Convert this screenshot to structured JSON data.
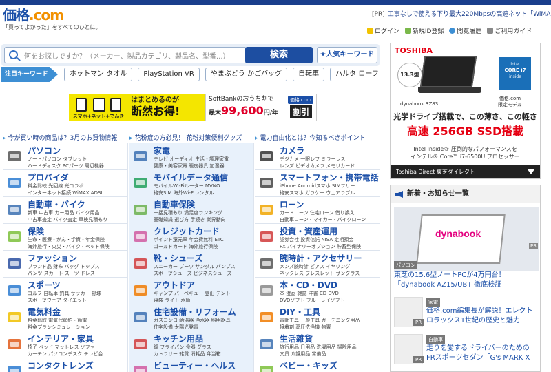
{
  "header": {
    "logo_main": "価格",
    "logo_dot": ".com",
    "tagline": "「買ってよかった」をすべてのひとに。",
    "pr_tag": "[PR]",
    "pr_text": "工事なしで使える下り最大220Mbpsの高速ネット「WiMAX」解説",
    "nav": [
      {
        "label": "ログイン",
        "icon": "key-icon",
        "color": "#f2c300"
      },
      {
        "label": "新規ID登録",
        "icon": "add-user-icon",
        "color": "#7ab84a"
      },
      {
        "label": "閲覧履歴",
        "icon": "history-icon",
        "color": "#3d8fd4"
      },
      {
        "label": "ご利用ガイド",
        "icon": "guide-icon",
        "color": "#888888"
      }
    ]
  },
  "search": {
    "placeholder": "何をお探しですか？（メーカー、製品カテゴリ、製品名、型番...）",
    "button": "検索",
    "popular": "★人気キーワード"
  },
  "keywords": {
    "label": "注目キーワード",
    "items": [
      "ホットマン タオル",
      "PlayStation VR",
      "やまぶどう かごバッグ",
      "自転車",
      "ハルタ ローファ"
    ]
  },
  "banner": {
    "tiles": [
      "スマホ",
      "ネット",
      "でんき"
    ],
    "line1": "はまとめるのが",
    "line2": "断然お得!",
    "sb": "SoftBankのおうち割で",
    "max": "最大",
    "amount": "99,600",
    "unit": "円/年",
    "discount": "割引",
    "brand": "価格.com"
  },
  "promos": [
    "今が買い時の商品は？3月のお買物情報",
    "花粉症の方必見！ 花粉対策便利グッズ",
    "電力自由化とは？今知るべきポイント"
  ],
  "categories": [
    {
      "title": "パソコン",
      "sub": [
        "ノートパソコン タブレット",
        "ハードディスク PCパーツ 周辺機器"
      ],
      "icon": "laptop-icon",
      "color": "#555555"
    },
    {
      "title": "家電",
      "sub": [
        "テレビ オーディオ 生活・調理家電",
        "健康・美容家電 暖房器具 加湿器"
      ],
      "icon": "appliance-icon",
      "color": "#3a6fb0"
    },
    {
      "title": "カメラ",
      "sub": [
        "デジカメ 一眼レフ ミラーレス",
        "レンズ ビデオカメラ メモリカード"
      ],
      "icon": "camera-icon",
      "color": "#333333"
    },
    {
      "title": "プロバイダ",
      "sub": [
        "料金比較 光回線 光コラボ",
        "インターネット接続 WiMAX ADSL"
      ],
      "icon": "globe-icon",
      "color": "#2a7ad0"
    },
    {
      "title": "モバイルデータ通信",
      "sub": [
        "モバイルWi-Fiルーター MVNO",
        "格安SIM 海外Wi-Fiレンタル"
      ],
      "icon": "wifi-icon",
      "color": "#21a05a"
    },
    {
      "title": "スマートフォン・携帯電話",
      "sub": [
        "iPhone Androidスマホ SIMフリー",
        "格安スマホ ガラケー ウェアラブル"
      ],
      "icon": "smartphone-icon",
      "color": "#444444"
    },
    {
      "title": "自動車・バイク",
      "sub": [
        "新車 中古車 カー用品 バイク用品",
        "中古車査定 バイク査定 車検見積もり"
      ],
      "icon": "car-icon",
      "color": "#3a6fb0"
    },
    {
      "title": "自動車保険",
      "sub": [
        "一括見積もり 満足度ランキング",
        "基礎知識 選び方 手続き 業界動向"
      ],
      "icon": "clover-leaf-icon",
      "color": "#6ab04c"
    },
    {
      "title": "ローン",
      "sub": [
        "カードローン 住宅ローン 借り換え",
        "自動車ローン・マイカー・バイクローン"
      ],
      "icon": "coins-icon",
      "color": "#f0a500"
    },
    {
      "title": "保険",
      "sub": [
        "生命・医療・がん・学資・年金保険",
        "海外旅行・火災・バイク・ペット保険"
      ],
      "icon": "clover-icon",
      "color": "#7bbf3a"
    },
    {
      "title": "クレジットカード",
      "sub": [
        "ポイント還元率 年会費無料 ETC",
        "ゴールドカード 海外旅行保険"
      ],
      "icon": "credit-card-icon",
      "color": "#d05aa0"
    },
    {
      "title": "投資・資産運用",
      "sub": [
        "証券会社 投資信託 NISA 定期預金",
        "FX バイナリーオプション 貯蓄型保険"
      ],
      "icon": "chart-icon",
      "color": "#d03a3a"
    },
    {
      "title": "ファッション",
      "sub": [
        "ブランド品 財布 バッグ トップス",
        "パンツ スカート スーツ ドレス"
      ],
      "icon": "shirt-icon",
      "color": "#2a4fa0"
    },
    {
      "title": "靴・シューズ",
      "sub": [
        "スニーカー ブーツ サンダル パンプス",
        "スポーツシューズ ビジネスシューズ"
      ],
      "icon": "shoe-icon",
      "color": "#d03a3a"
    },
    {
      "title": "腕時計・アクセサリー",
      "sub": [
        "メンズ腕時計 ピアス イヤリング",
        "ネックレス ブレスレット サングラス"
      ],
      "icon": "watch-icon",
      "color": "#555555"
    },
    {
      "title": "スポーツ",
      "sub": [
        "ゴルフ 自転車 釣具 サッカー 野球",
        "スポーツウェア ダイエット"
      ],
      "icon": "bicycle-icon",
      "color": "#2a7ad0"
    },
    {
      "title": "アウトドア",
      "sub": [
        "キャンプ バーベキュー 登山 テント",
        "寝袋 ライト 水筒"
      ],
      "icon": "tent-icon",
      "color": "#f07a00"
    },
    {
      "title": "本・CD・DVD",
      "sub": [
        "本 漫画 雑誌 洋書 CD DVD",
        "DVDソフト ブルーレイソフト"
      ],
      "icon": "disc-icon",
      "color": "#888888"
    },
    {
      "title": "電気料金",
      "sub": [
        "料金比較 電気代節約・節電",
        "料金プランシミュレーション"
      ],
      "icon": "bulb-icon",
      "color": "#f0c000"
    },
    {
      "title": "住宅設備・リフォーム",
      "sub": [
        "ガスコンロ 給湯器 浄水器 照明器具",
        "住宅設備 太陽光発電"
      ],
      "icon": "house-icon",
      "color": "#3a6fb0"
    },
    {
      "title": "DIY・工具",
      "sub": [
        "電動工具 一般工具 ガーデニング用品",
        "接着剤 高圧洗浄機 物置"
      ],
      "icon": "drill-icon",
      "color": "#f07a00"
    },
    {
      "title": "インテリア・家具",
      "sub": [
        "椅子 ベッド マットレス ソファ",
        "カーテン パソコンデスク テレビ台"
      ],
      "icon": "chair-icon",
      "color": "#e05a1a"
    },
    {
      "title": "キッチン用品",
      "sub": [
        "鍋 フライパン 食器 グラス",
        "カトラリー 雑貨 消耗品 弁当箱"
      ],
      "icon": "pot-icon",
      "color": "#d03a3a"
    },
    {
      "title": "生活雑貨",
      "sub": [
        "旅行用品 日用品 洗濯用品 掃除用品",
        "文具 介護用品 常備品"
      ],
      "icon": "bottle-icon",
      "color": "#3a6fb0"
    },
    {
      "title": "コンタクトレンズ",
      "sub": [],
      "icon": "lens-icon",
      "color": "#2a7ad0"
    },
    {
      "title": "ビューティー・ヘルス",
      "sub": [],
      "icon": "cosmetics-icon",
      "color": "#d05aa0"
    },
    {
      "title": "ベビー・キッズ",
      "sub": [],
      "icon": "baby-icon",
      "color": "#7bbf3a"
    }
  ],
  "ad": {
    "brand": "TOSHIBA",
    "size": "13.3型",
    "intel1": "intel",
    "intel2": "CORE i7",
    "intel3": "inside",
    "model": "dynabook RZ83",
    "model_right1": "価格.com",
    "model_right2": "限定モデル",
    "headline1": "光学ドライブ搭載で、この薄さ、この軽さ",
    "headline2": "高速 256GB SSD搭載",
    "spec1": "Intel Inside® 圧倒的なパフォーマンスを",
    "spec2": "インテル® Core™ i7-6500U プロセッサー",
    "footer": "Toshiba Direct  東芝ダイレクト"
  },
  "news": {
    "title": "新着・お知らせ一覧",
    "hero_logo": "dynabook",
    "hero_pr": "PR",
    "items": [
      {
        "category": "パソコン",
        "title": "東芝の15.6型ノートPCが4万円台！「dynabook AZ15/UB」徹底検証",
        "pr": ""
      },
      {
        "category": "家電",
        "title": "価格.com編集長が解説！エレクトロラックス1世紀の歴史と魅力",
        "pr": "PR"
      },
      {
        "category": "自動車",
        "title": "走りを愛するドライバーのためのFRスポーツセダン「G's MARK X」",
        "pr": "PR"
      }
    ]
  }
}
